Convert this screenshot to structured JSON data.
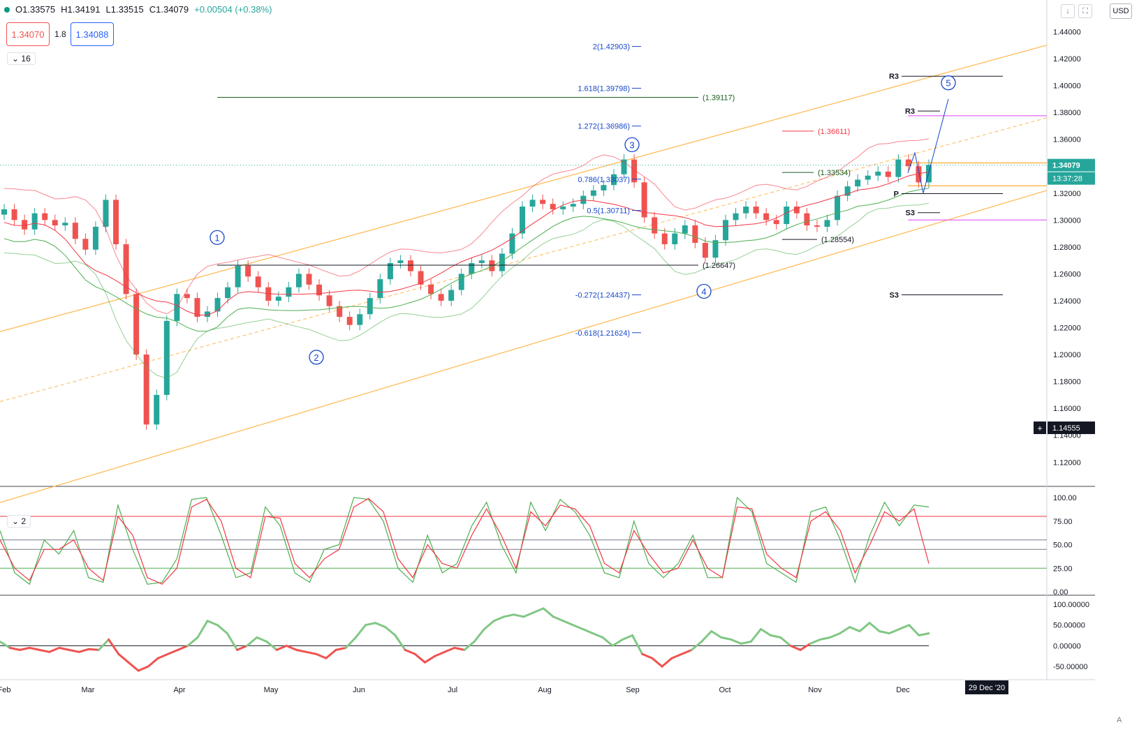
{
  "header": {
    "open": "O1.33575",
    "high": "H1.34191",
    "low": "L1.33515",
    "close": "C1.34079",
    "change": "+0.00504 (+0.38%)",
    "sell_quote": "1.34070",
    "spread": "1.8",
    "buy_quote": "1.34088",
    "main_study_count": "16",
    "osc_study_count": "2"
  },
  "toolbar": {
    "currency": "USD",
    "down_icon": "arrow-down-icon",
    "fullscreen_icon": "fullscreen-icon",
    "auto_label": "A"
  },
  "chart_data": [
    {
      "type": "candlestick",
      "title": "",
      "x_ticks": [
        "Feb",
        "Mar",
        "Apr",
        "May",
        "Jun",
        "Jul",
        "Aug",
        "Sep",
        "Oct",
        "Nov",
        "Dec"
      ],
      "y_ticks": [
        "1.44000",
        "1.42000",
        "1.40000",
        "1.38000",
        "1.36000",
        "1.34000",
        "1.32000",
        "1.30000",
        "1.28000",
        "1.26000",
        "1.24000",
        "1.22000",
        "1.20000",
        "1.18000",
        "1.16000",
        "1.14000",
        "1.12000"
      ],
      "ylim": [
        1.102,
        1.448
      ],
      "current_price": "1.34079",
      "countdown": "13:37:28",
      "crosshair_price": "1.14555",
      "crosshair_date": "29 Dec '20",
      "close_path": [
        1.308,
        1.3,
        1.293,
        1.305,
        1.3,
        1.296,
        1.298,
        1.286,
        1.278,
        1.295,
        1.315,
        1.282,
        1.245,
        1.2,
        1.148,
        1.17,
        1.225,
        1.245,
        1.242,
        1.228,
        1.232,
        1.242,
        1.25,
        1.266,
        1.258,
        1.25,
        1.24,
        1.243,
        1.25,
        1.26,
        1.252,
        1.244,
        1.236,
        1.228,
        1.222,
        1.23,
        1.242,
        1.256,
        1.268,
        1.27,
        1.262,
        1.252,
        1.245,
        1.24,
        1.248,
        1.26,
        1.268,
        1.27,
        1.262,
        1.275,
        1.29,
        1.31,
        1.315,
        1.312,
        1.308,
        1.31,
        1.312,
        1.318,
        1.322,
        1.326,
        1.334,
        1.345,
        1.328,
        1.302,
        1.29,
        1.282,
        1.29,
        1.296,
        1.283,
        1.272,
        1.285,
        1.3,
        1.305,
        1.31,
        1.305,
        1.3,
        1.297,
        1.31,
        1.305,
        1.296,
        1.295,
        1.3,
        1.318,
        1.325,
        1.33,
        1.333,
        1.336,
        1.332,
        1.345,
        1.34,
        1.328,
        1.341
      ],
      "fib_levels": [
        {
          "label": "2(1.42903)",
          "value": 1.42903
        },
        {
          "label": "1.618(1.39798)",
          "value": 1.39798
        },
        {
          "label": "1.272(1.36986)",
          "value": 1.36986
        },
        {
          "label": "0.786(1.33037)",
          "value": 1.33037
        },
        {
          "label": "0.5(1.30711)",
          "value": 1.30711
        },
        {
          "label": "-0.272(1.24437)",
          "value": 1.24437
        },
        {
          "label": "-0.618(1.21624)",
          "value": 1.21624
        }
      ],
      "price_levels": [
        {
          "label": "(1.39117)",
          "value": 1.39117,
          "color": "#1b5e20"
        },
        {
          "label": "(1.36611)",
          "value": 1.36611,
          "color": "#f23645"
        },
        {
          "label": "(1.33534)",
          "value": 1.33534,
          "color": "#1b5e20"
        },
        {
          "label": "(1.28554)",
          "value": 1.28554,
          "color": "#131722"
        },
        {
          "label": "(1.26647)",
          "value": 1.26647,
          "color": "#131722"
        }
      ],
      "pivots": [
        {
          "label": "R3",
          "value": 1.40692
        },
        {
          "label": "R3",
          "value": 1.38104
        },
        {
          "label": "P",
          "value": 1.31958
        },
        {
          "label": "S3",
          "value": 1.30548
        },
        {
          "label": "S3",
          "value": 1.24437
        }
      ],
      "waves": [
        "1",
        "2",
        "3",
        "4",
        "5"
      ],
      "colors": {
        "up": "#26a69a",
        "down": "#ef5350",
        "channel": "#ffb74d",
        "ma_red": "#f23645",
        "ma_green": "#4caf50",
        "wave": "#1848cc",
        "magenta": "#e040fb",
        "orange": "#ff9800"
      }
    },
    {
      "type": "line",
      "title": "",
      "y_ticks": [
        "100.00",
        "75.00",
        "50.00",
        "25.00",
        "0.00"
      ],
      "ylim": [
        0,
        100
      ],
      "levels": [
        80,
        55,
        45,
        25
      ],
      "series": [
        {
          "color": "#4caf50",
          "values": [
            65,
            20,
            8,
            55,
            40,
            65,
            15,
            10,
            92,
            45,
            8,
            10,
            35,
            98,
            100,
            60,
            15,
            20,
            90,
            70,
            20,
            10,
            45,
            50,
            100,
            98,
            75,
            25,
            10,
            60,
            20,
            30,
            70,
            95,
            50,
            20,
            95,
            65,
            98,
            85,
            60,
            20,
            15,
            75,
            30,
            15,
            30,
            60,
            15,
            15,
            100,
            85,
            30,
            20,
            10,
            85,
            90,
            55,
            10,
            60,
            95,
            70,
            92,
            90
          ]
        },
        {
          "color": "#f23645",
          "values": [
            55,
            25,
            12,
            45,
            45,
            55,
            25,
            12,
            80,
            60,
            15,
            8,
            25,
            90,
            98,
            75,
            25,
            15,
            80,
            78,
            30,
            15,
            35,
            45,
            90,
            99,
            85,
            35,
            15,
            50,
            30,
            25,
            60,
            88,
            60,
            25,
            85,
            70,
            92,
            88,
            70,
            30,
            20,
            65,
            40,
            20,
            25,
            55,
            25,
            15,
            90,
            88,
            40,
            25,
            15,
            75,
            85,
            65,
            20,
            50,
            85,
            75,
            88,
            30
          ]
        }
      ]
    },
    {
      "type": "line",
      "title": "",
      "y_ticks": [
        "100.00000",
        "50.00000",
        "0.00000",
        "-50.00000"
      ],
      "ylim": [
        -75,
        110
      ],
      "values": [
        10,
        -5,
        -10,
        -5,
        -10,
        -15,
        -5,
        -10,
        -15,
        -8,
        -10,
        15,
        -20,
        -40,
        -60,
        -50,
        -30,
        -20,
        -10,
        0,
        20,
        60,
        50,
        30,
        -10,
        0,
        20,
        10,
        -10,
        0,
        -10,
        -15,
        -20,
        -30,
        -10,
        -5,
        20,
        50,
        55,
        45,
        25,
        -10,
        -20,
        -40,
        -25,
        -15,
        -5,
        -10,
        10,
        40,
        60,
        70,
        75,
        70,
        80,
        90,
        70,
        60,
        50,
        40,
        30,
        20,
        0,
        15,
        25,
        -20,
        -30,
        -50,
        -30,
        -20,
        -10,
        10,
        35,
        20,
        15,
        5,
        10,
        40,
        25,
        20,
        0,
        -10,
        5,
        15,
        20,
        30,
        45,
        35,
        55,
        35,
        30,
        40,
        50,
        25,
        30
      ],
      "zero_line": 0
    }
  ],
  "axis_labels": {
    "x": [
      "Feb",
      "Mar",
      "Apr",
      "May",
      "Jun",
      "Jul",
      "Aug",
      "Sep",
      "Oct",
      "Nov",
      "Dec"
    ]
  }
}
